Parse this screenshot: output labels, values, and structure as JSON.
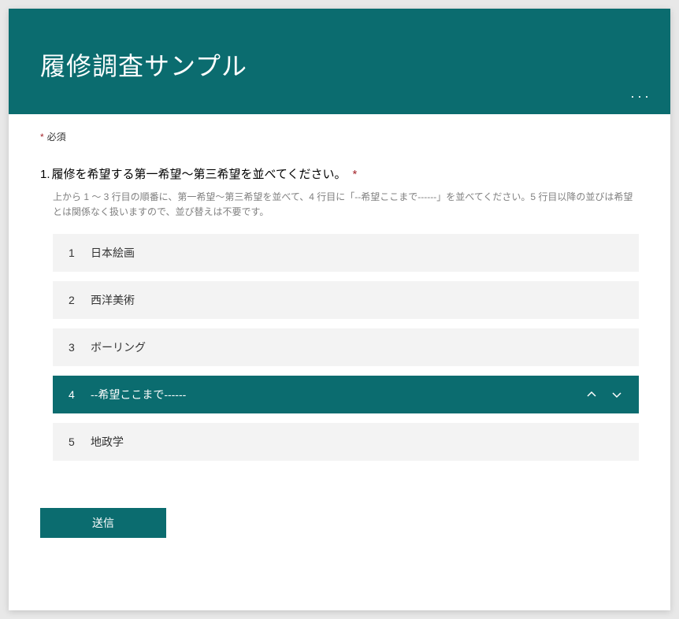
{
  "colors": {
    "accent": "#0b6c6f",
    "requiredMark": "#a4262c"
  },
  "header": {
    "title": "履修調査サンプル"
  },
  "requiredNote": {
    "asterisk": "*",
    "label": "必須"
  },
  "question": {
    "number": "1.",
    "title": "履修を希望する第一希望～第三希望を並べてください。",
    "requiredMark": "*",
    "description": "上から 1 ～ 3 行目の順番に、第一希望～第三希望を並べて、4 行目に「--希望ここまで------」を並べてください。5 行目以降の並びは希望とは関係なく扱いますので、並び替えは不要です。",
    "items": [
      {
        "index": "1",
        "label": "日本絵画",
        "selected": false
      },
      {
        "index": "2",
        "label": "西洋美術",
        "selected": false
      },
      {
        "index": "3",
        "label": "ボーリング",
        "selected": false
      },
      {
        "index": "4",
        "label": "--希望ここまで------",
        "selected": true
      },
      {
        "index": "5",
        "label": "地政学",
        "selected": false
      }
    ]
  },
  "submit": {
    "label": "送信"
  }
}
